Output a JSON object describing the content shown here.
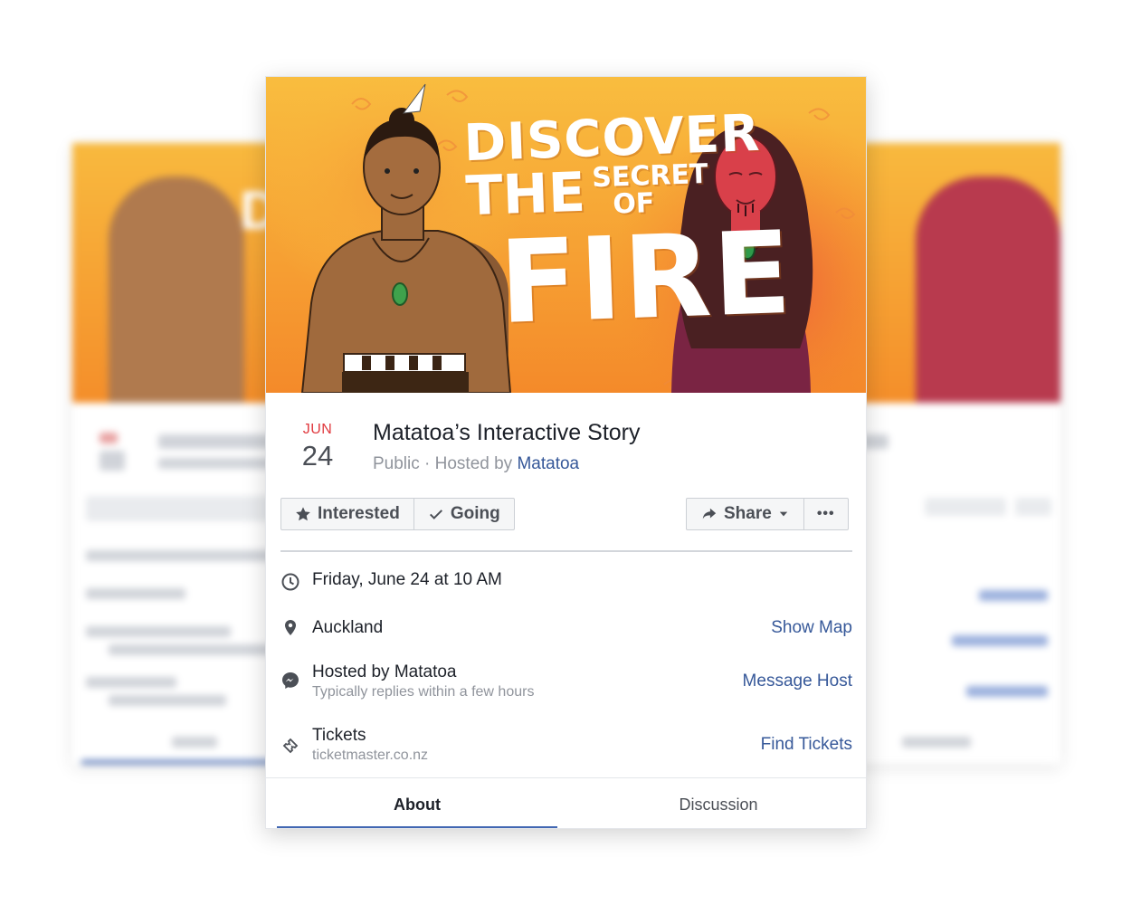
{
  "event": {
    "month": "JUN",
    "day": "24",
    "title": "Matatoa’s Interactive Story",
    "privacy_prefix": "Public · Hosted by ",
    "host_link": "Matatoa"
  },
  "banner": {
    "line1": "DISCOVER",
    "line2": "THE",
    "line3a": "SECRET",
    "line3b": "OF",
    "line4": "FIRE"
  },
  "actions": {
    "interested": "Interested",
    "going": "Going",
    "share": "Share",
    "more": "•••"
  },
  "details": {
    "datetime": "Friday, June 24 at 10 AM",
    "location": "Auckland",
    "location_link": "Show Map",
    "host": "Hosted by Matatoa",
    "host_sub": "Typically replies within a few hours",
    "host_link": "Message Host",
    "tickets": "Tickets",
    "tickets_sub": "ticketmaster.co.nz",
    "tickets_link": "Find Tickets"
  },
  "tabs": {
    "about": "About",
    "discussion": "Discussion"
  },
  "colors": {
    "accent": "#4267b2",
    "link": "#365899",
    "month": "#e0393e",
    "banner_top": "#f8b93e",
    "banner_bottom": "#f48e2a"
  },
  "icons": [
    "star-icon",
    "check-icon",
    "share-arrow-icon",
    "caret-down-icon",
    "clock-icon",
    "location-pin-icon",
    "messenger-icon",
    "ticket-icon"
  ]
}
